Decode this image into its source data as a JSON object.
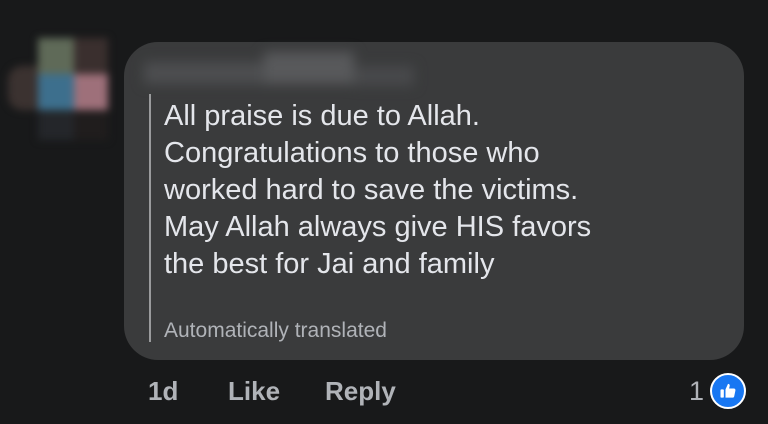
{
  "comment": {
    "text_lines": [
      "All praise is due to Allah.",
      "Congratulations to those who",
      "worked hard to save the victims.",
      "May Allah always give HIS favors",
      "the best for Jai and family"
    ],
    "translation_note": "Automatically translated"
  },
  "actions": {
    "time": "1d",
    "like_label": "Like",
    "reply_label": "Reply"
  },
  "reactions": {
    "count": "1",
    "icon": "thumbs-up-icon",
    "icon_color": "#1877f2"
  },
  "colors": {
    "background": "#18191a",
    "bubble": "#3a3b3c",
    "primary_text": "#e4e6eb",
    "secondary_text": "#b0b3b8"
  }
}
